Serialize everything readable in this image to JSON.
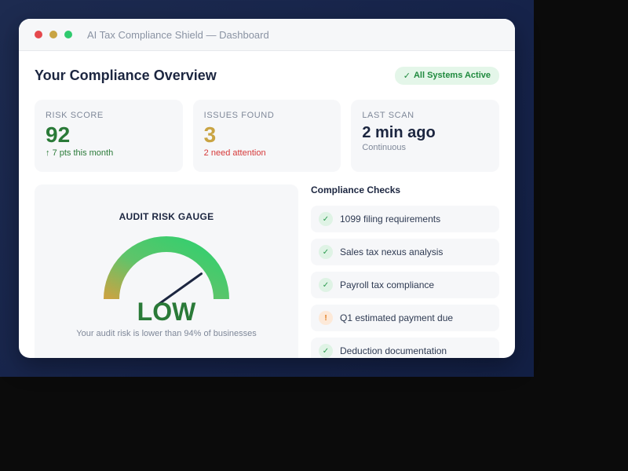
{
  "window": {
    "title": "AI Tax Compliance Shield — Dashboard"
  },
  "header": {
    "title": "Your Compliance Overview",
    "status_badge": "All Systems Active",
    "status_icon": "check-icon"
  },
  "stats": [
    {
      "label": "RISK SCORE",
      "value": "92",
      "sub": "7 pts this month",
      "sub_icon": "arrow-up-icon"
    },
    {
      "label": "ISSUES FOUND",
      "value": "3",
      "sub": "2 need attention"
    },
    {
      "label": "LAST SCAN",
      "value": "2 min ago",
      "sub": "Continuous"
    }
  ],
  "gauge": {
    "title": "AUDIT RISK GAUGE",
    "level": "LOW",
    "caption": "Your audit risk is lower than 94% of businesses",
    "needle_fraction": 0.8
  },
  "checks": {
    "title": "Compliance Checks",
    "items": [
      {
        "label": "1099 filing requirements",
        "status": "ok",
        "icon": "check-icon"
      },
      {
        "label": "Sales tax nexus analysis",
        "status": "ok",
        "icon": "check-icon"
      },
      {
        "label": "Payroll tax compliance",
        "status": "ok",
        "icon": "check-icon"
      },
      {
        "label": "Q1 estimated payment due",
        "status": "warning",
        "icon": "warning-icon"
      },
      {
        "label": "Deduction documentation",
        "status": "ok",
        "icon": "check-icon"
      }
    ]
  },
  "colors": {
    "accent_green": "#2a7a38",
    "gold": "#c9a443",
    "danger": "#d63a3a",
    "navy": "#1c2640"
  }
}
